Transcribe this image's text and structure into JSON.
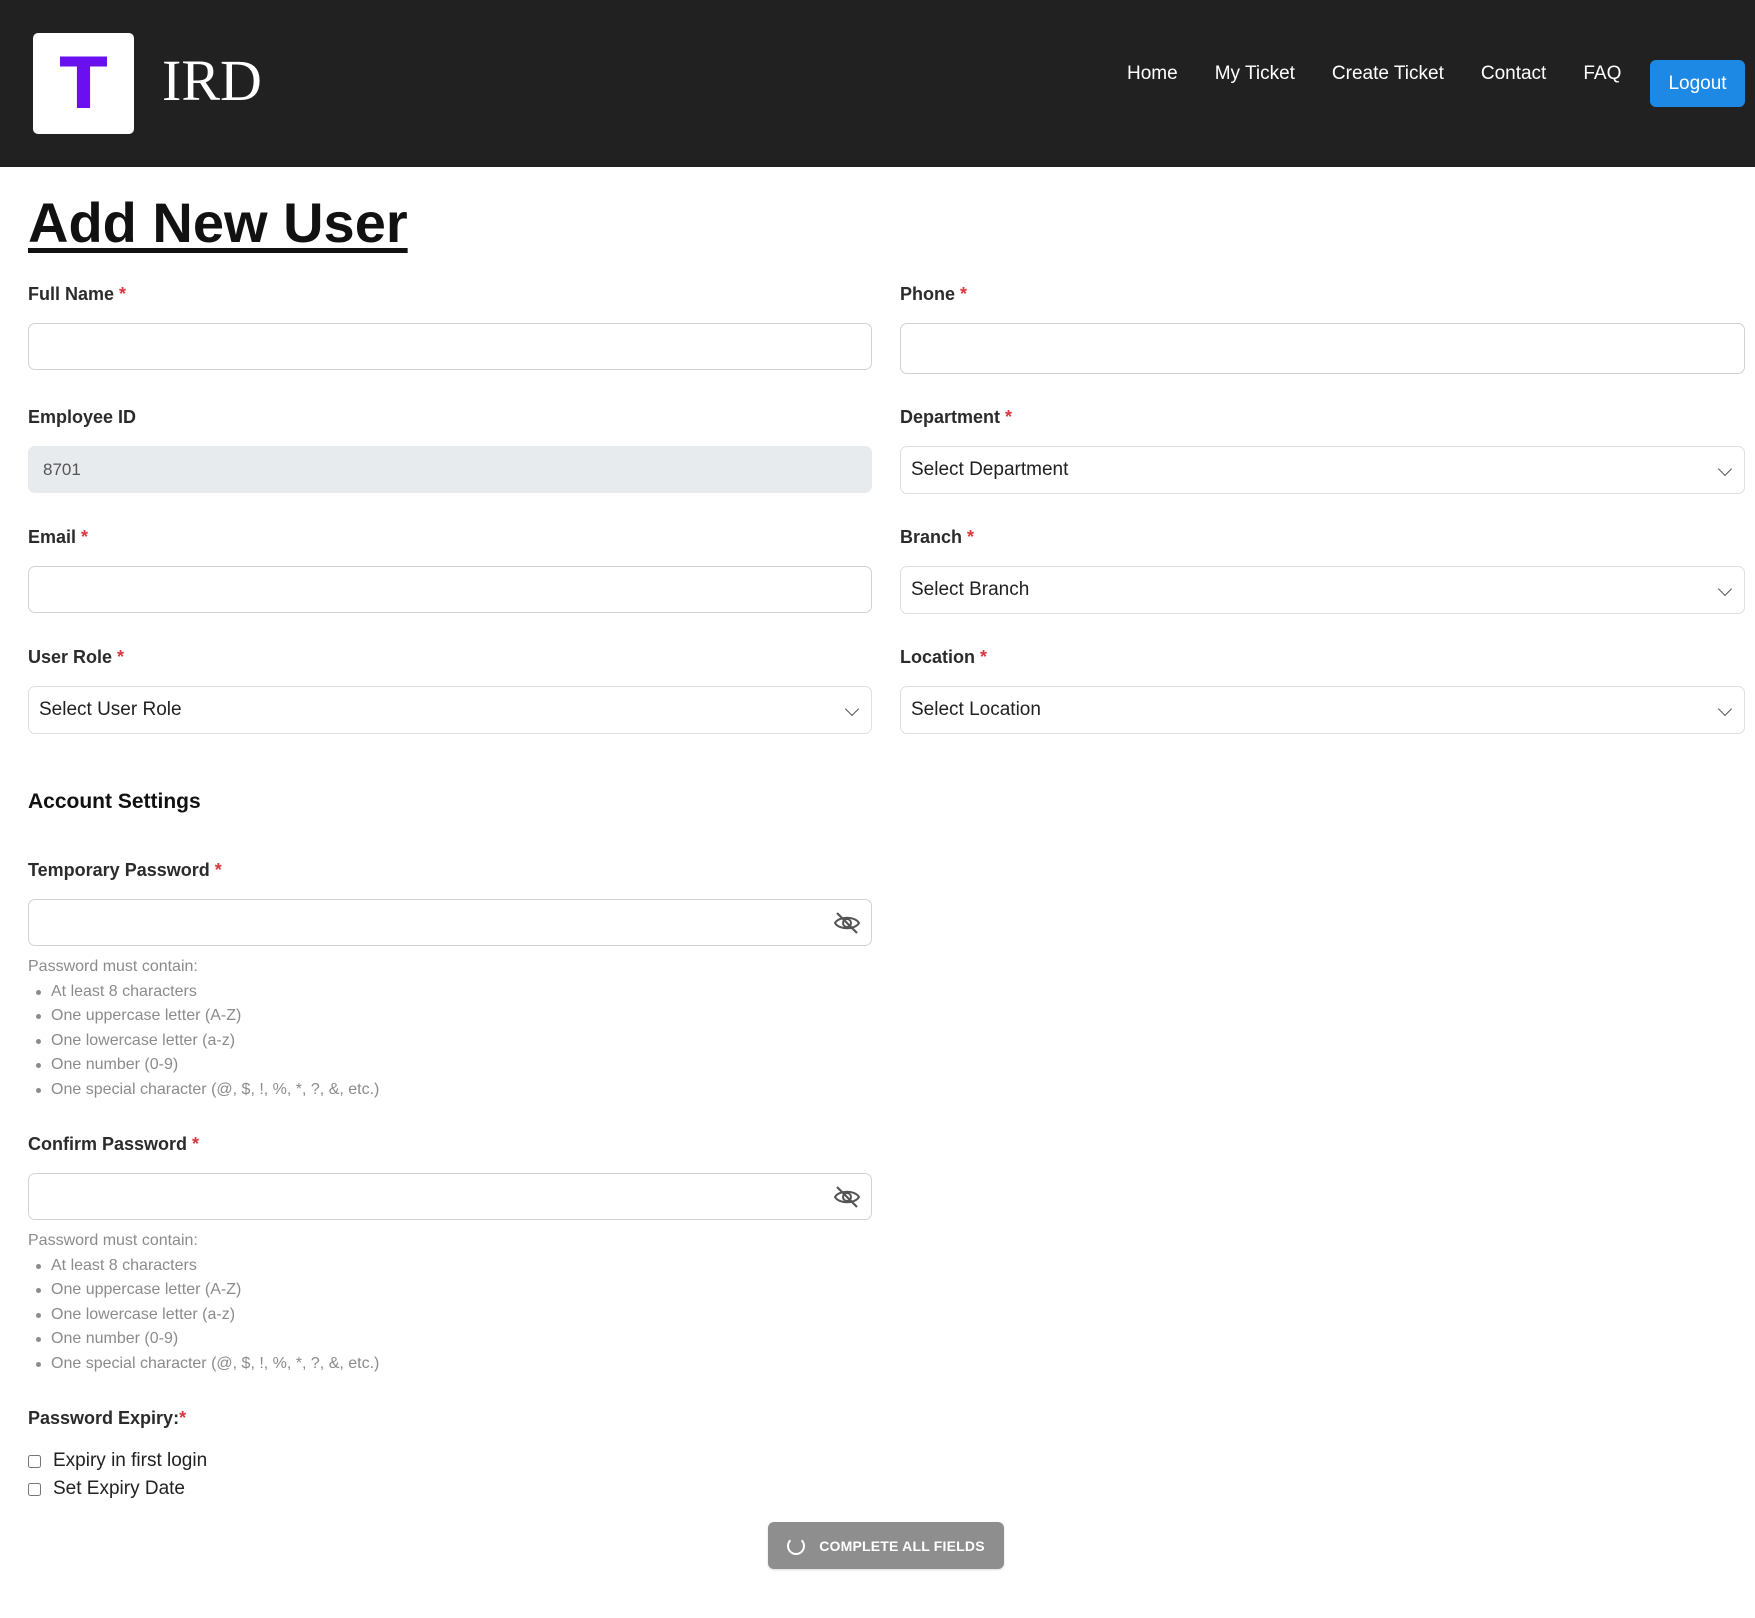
{
  "header": {
    "logo_letter": "T",
    "brand": "IRD",
    "nav": [
      "Home",
      "My Ticket",
      "Create Ticket",
      "Contact",
      "FAQ"
    ],
    "logout_label": "Logout"
  },
  "page_title": "Add New User",
  "form": {
    "full_name": {
      "label": "Full Name",
      "value": ""
    },
    "phone": {
      "label": "Phone",
      "value": ""
    },
    "employee_id": {
      "label": "Employee ID",
      "value": "8701"
    },
    "department": {
      "label": "Department",
      "selected": "Select Department"
    },
    "email": {
      "label": "Email",
      "value": ""
    },
    "branch": {
      "label": "Branch",
      "selected": "Select Branch"
    },
    "user_role": {
      "label": "User Role",
      "selected": "Select User Role"
    },
    "location": {
      "label": "Location",
      "selected": "Select Location"
    }
  },
  "account_settings": {
    "title": "Account Settings",
    "temp_password": {
      "label": "Temporary Password",
      "value": ""
    },
    "confirm_password": {
      "label": "Confirm Password",
      "value": ""
    },
    "hint_intro": "Password must contain:",
    "hint_rules": [
      "At least 8 characters",
      "One uppercase letter (A-Z)",
      "One lowercase letter (a-z)",
      "One number (0-9)",
      "One special character (@, $, !, %, *, ?, &, etc.)"
    ],
    "password_expiry": {
      "label": "Password Expiry:",
      "options": [
        {
          "label": "Expiry in first login",
          "checked": false
        },
        {
          "label": "Set Expiry Date",
          "checked": false
        }
      ]
    }
  },
  "submit_label": "COMPLETE ALL FIELDS",
  "icons": {
    "password_toggle": "eye-slash-icon",
    "select_arrow": "chevron-down-icon",
    "loading": "spinner-icon"
  },
  "colors": {
    "header_bg": "#212121",
    "logo_accent": "#6a0ff0",
    "logout_bg": "#1e88e5",
    "required": "#d9363e",
    "submit_disabled": "#8e8e8e"
  }
}
